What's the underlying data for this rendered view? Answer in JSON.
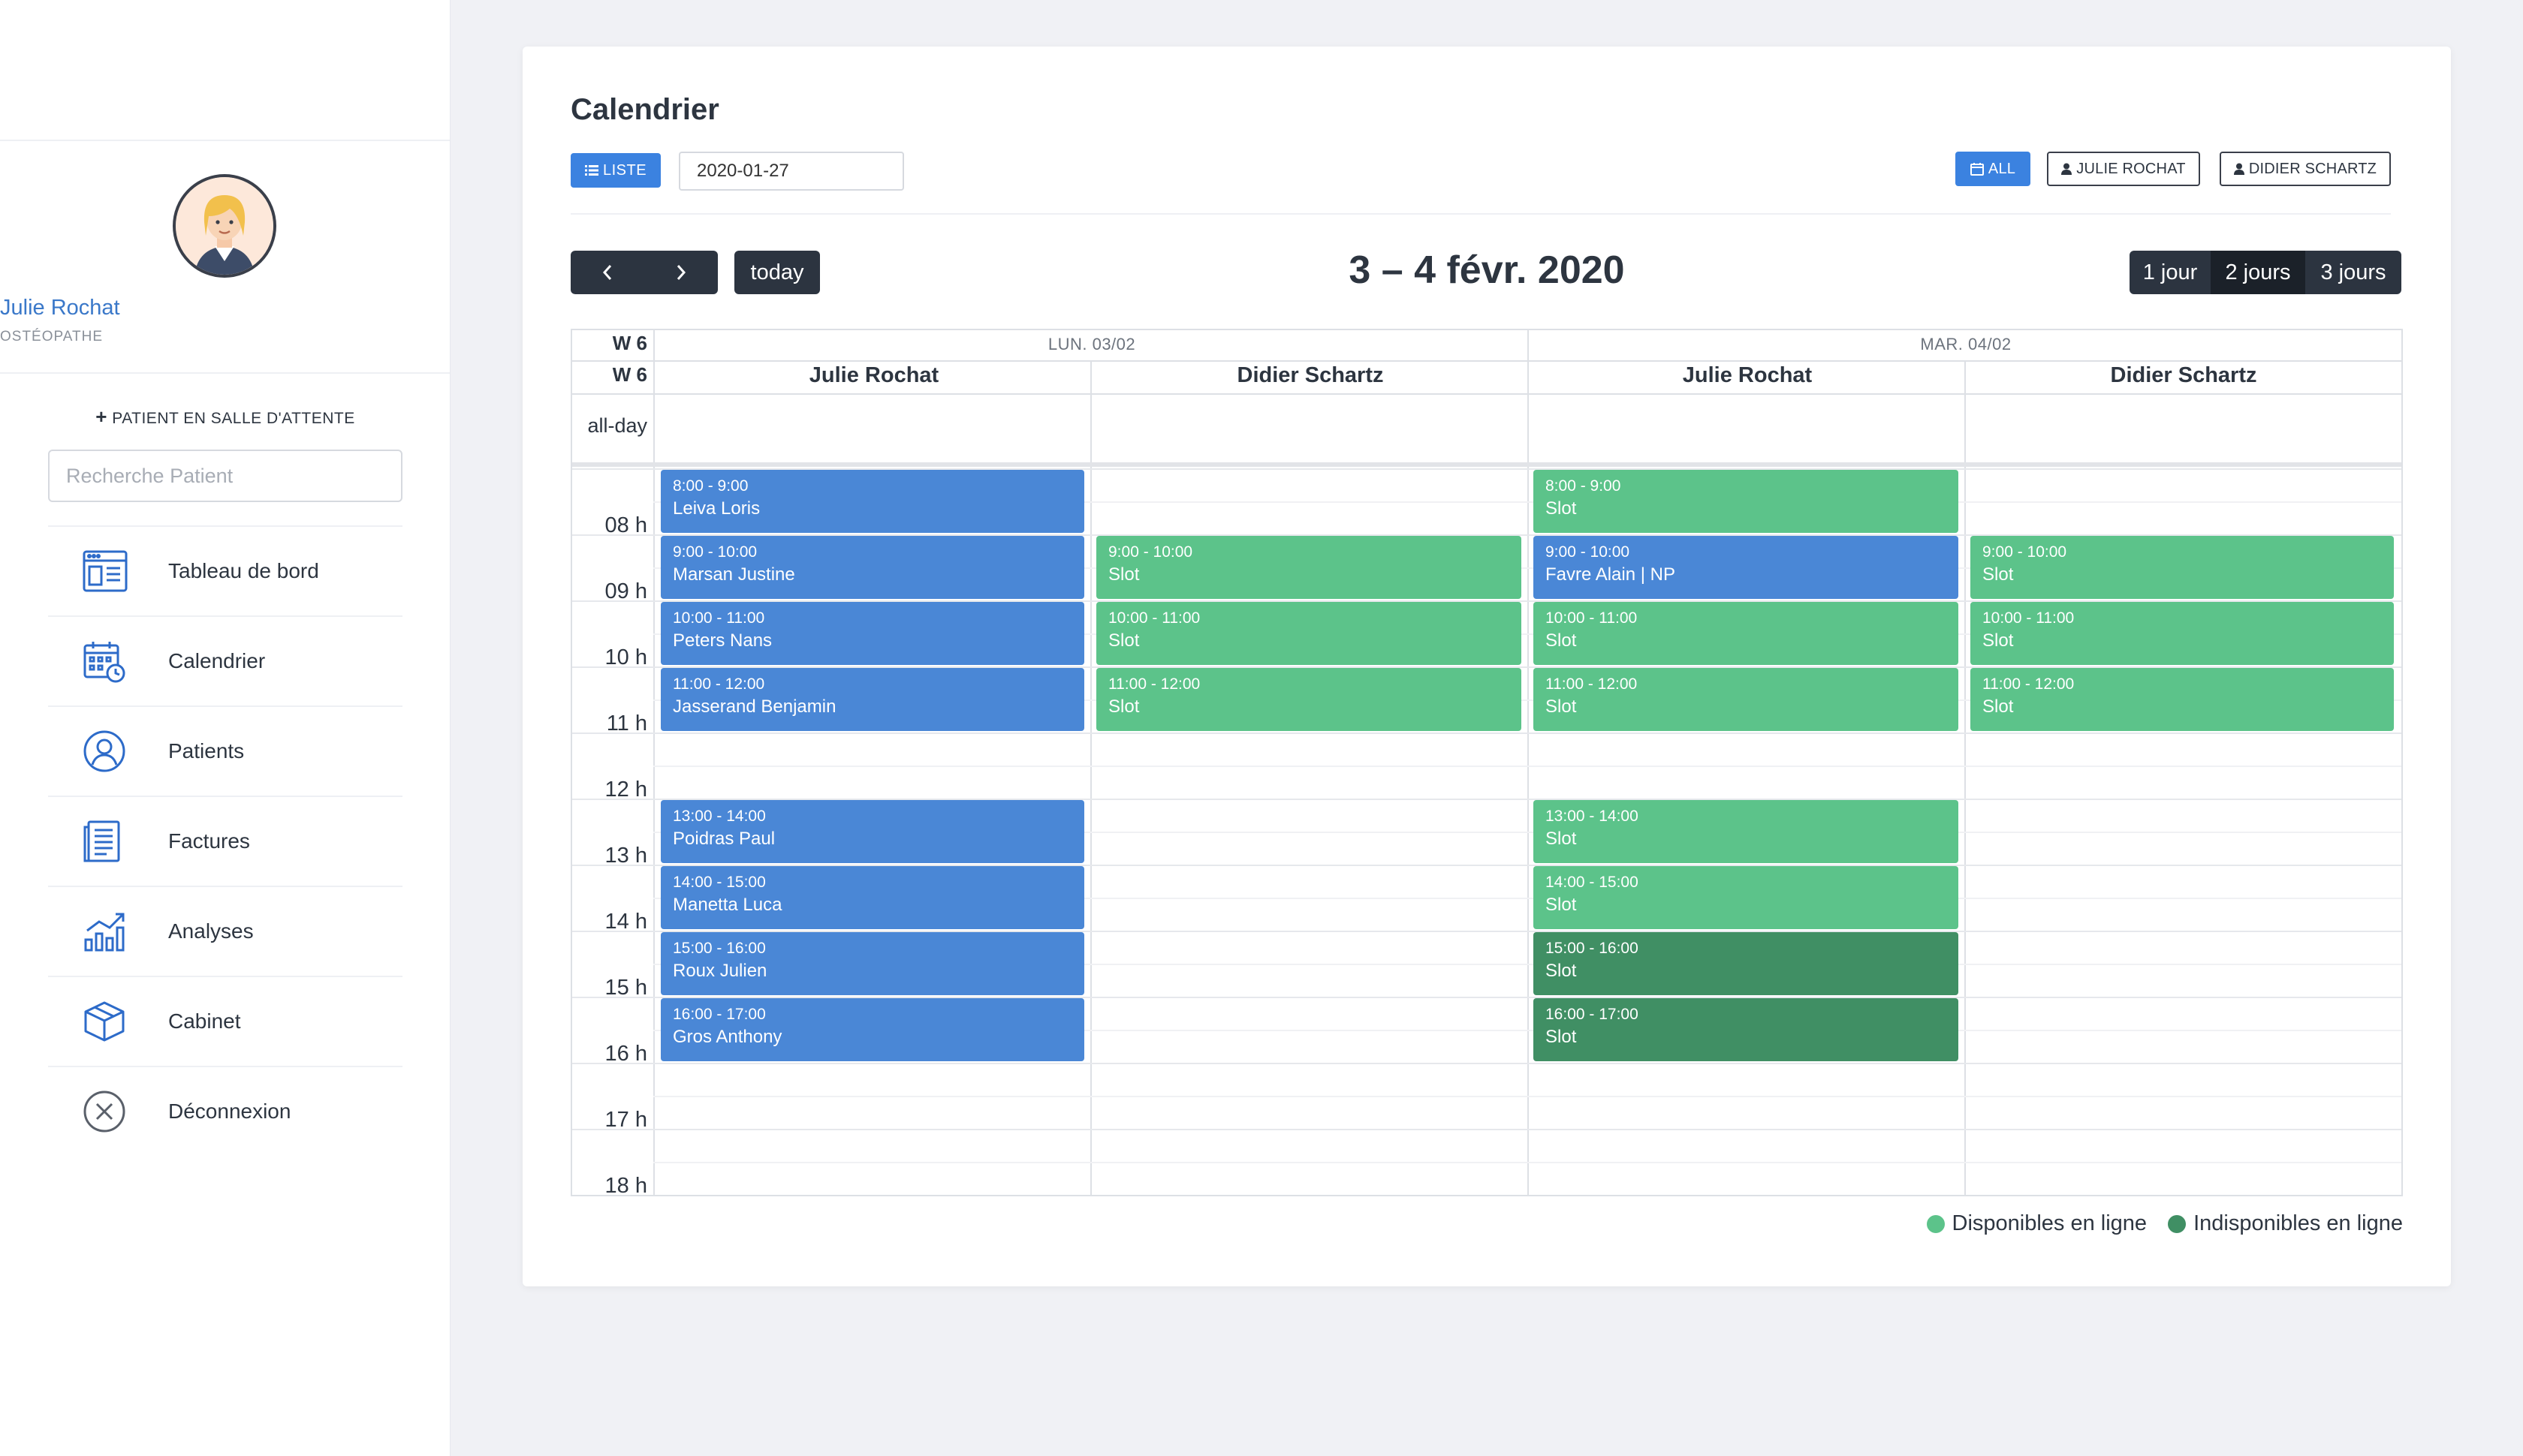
{
  "sidebar": {
    "profile": {
      "name": "Julie Rochat",
      "role": "OSTÉOPATHE"
    },
    "waiting_label": "PATIENT EN SALLE D'ATTENTE",
    "search_placeholder": "Recherche Patient",
    "items": [
      {
        "label": "Tableau de bord",
        "icon": "dashboard-icon"
      },
      {
        "label": "Calendrier",
        "icon": "calendar-icon"
      },
      {
        "label": "Patients",
        "icon": "user-circle-icon"
      },
      {
        "label": "Factures",
        "icon": "invoice-icon"
      },
      {
        "label": "Analyses",
        "icon": "chart-icon"
      },
      {
        "label": "Cabinet",
        "icon": "box-icon"
      },
      {
        "label": "Déconnexion",
        "icon": "close-circle-icon"
      }
    ]
  },
  "header": {
    "title": "Calendrier",
    "list_button": "LISTE",
    "date_value": "2020-01-27",
    "filters": {
      "all": "ALL",
      "julie": "JULIE ROCHAT",
      "didier": "DIDIER SCHARTZ"
    }
  },
  "toolbar": {
    "today": "today",
    "range_title": "3 – 4 févr. 2020",
    "views": [
      "1 jour",
      "2 jours",
      "3 jours"
    ]
  },
  "calendar": {
    "week_label": "W 6",
    "all_day_label": "all-day",
    "days": [
      "LUN. 03/02",
      "MAR. 04/02"
    ],
    "resources": [
      "Julie Rochat",
      "Didier Schartz",
      "Julie Rochat",
      "Didier Schartz"
    ],
    "hours": [
      "08 h",
      "09 h",
      "10 h",
      "11 h",
      "12 h",
      "13 h",
      "14 h",
      "15 h",
      "16 h",
      "17 h",
      "18 h"
    ],
    "events": [
      {
        "col": 0,
        "start": 8,
        "time": "8:00 - 9:00",
        "title": "Leiva Loris",
        "kind": "blue"
      },
      {
        "col": 0,
        "start": 9,
        "time": "9:00 - 10:00",
        "title": "Marsan Justine",
        "kind": "blue"
      },
      {
        "col": 0,
        "start": 10,
        "time": "10:00 - 11:00",
        "title": "Peters Nans",
        "kind": "blue"
      },
      {
        "col": 0,
        "start": 11,
        "time": "11:00 - 12:00",
        "title": "Jasserand Benjamin",
        "kind": "blue"
      },
      {
        "col": 0,
        "start": 13,
        "time": "13:00 - 14:00",
        "title": "Poidras Paul",
        "kind": "blue"
      },
      {
        "col": 0,
        "start": 14,
        "time": "14:00 - 15:00",
        "title": "Manetta Luca",
        "kind": "blue"
      },
      {
        "col": 0,
        "start": 15,
        "time": "15:00 - 16:00",
        "title": "Roux Julien",
        "kind": "blue"
      },
      {
        "col": 0,
        "start": 16,
        "time": "16:00 - 17:00",
        "title": "Gros Anthony",
        "kind": "blue"
      },
      {
        "col": 1,
        "start": 9,
        "time": "9:00 - 10:00",
        "title": "Slot",
        "kind": "green"
      },
      {
        "col": 1,
        "start": 10,
        "time": "10:00 - 11:00",
        "title": "Slot",
        "kind": "green"
      },
      {
        "col": 1,
        "start": 11,
        "time": "11:00 - 12:00",
        "title": "Slot",
        "kind": "green"
      },
      {
        "col": 2,
        "start": 8,
        "time": "8:00 - 9:00",
        "title": "Slot",
        "kind": "green"
      },
      {
        "col": 2,
        "start": 9,
        "time": "9:00 - 10:00",
        "title": "Favre Alain | NP",
        "kind": "blue"
      },
      {
        "col": 2,
        "start": 10,
        "time": "10:00 - 11:00",
        "title": "Slot",
        "kind": "green"
      },
      {
        "col": 2,
        "start": 11,
        "time": "11:00 - 12:00",
        "title": "Slot",
        "kind": "green"
      },
      {
        "col": 2,
        "start": 13,
        "time": "13:00 - 14:00",
        "title": "Slot",
        "kind": "green"
      },
      {
        "col": 2,
        "start": 14,
        "time": "14:00 - 15:00",
        "title": "Slot",
        "kind": "green"
      },
      {
        "col": 2,
        "start": 15,
        "time": "15:00 - 16:00",
        "title": "Slot",
        "kind": "dark"
      },
      {
        "col": 2,
        "start": 16,
        "time": "16:00 - 17:00",
        "title": "Slot",
        "kind": "dark"
      },
      {
        "col": 3,
        "start": 9,
        "time": "9:00 - 10:00",
        "title": "Slot",
        "kind": "green"
      },
      {
        "col": 3,
        "start": 10,
        "time": "10:00 - 11:00",
        "title": "Slot",
        "kind": "green"
      },
      {
        "col": 3,
        "start": 11,
        "time": "11:00 - 12:00",
        "title": "Slot",
        "kind": "green"
      }
    ]
  },
  "legend": {
    "available": "Disponibles en ligne",
    "unavailable": "Indisponibles en ligne"
  },
  "colors": {
    "primary": "#3b82e0",
    "appointment": "#4a87d6",
    "available": "#5cc38a",
    "unavailable": "#408f64",
    "dark_button": "#2c3440"
  }
}
